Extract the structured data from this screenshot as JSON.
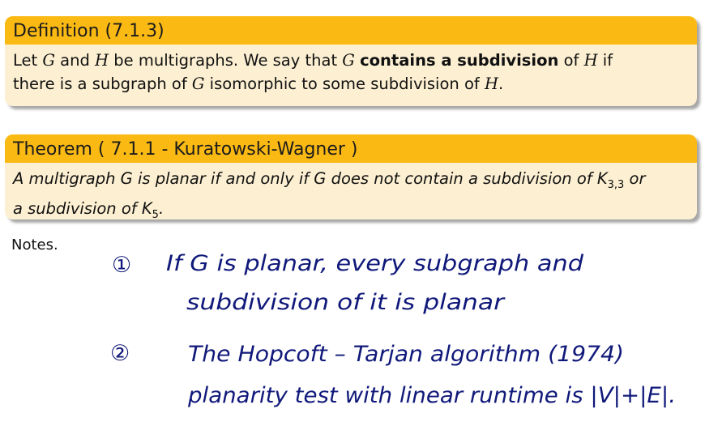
{
  "definition": {
    "title": "Definition (7.1.3)",
    "t1": "Let ",
    "v1": "G",
    "t2": " and ",
    "v2": "H",
    "t3": " be multigraphs. We say that ",
    "v3": "G",
    "t4": " ",
    "bold": "contains a subdivision",
    "t5": " of ",
    "v4": "H",
    "t6": " if",
    "t7": "there is a subgraph of ",
    "v5": "G",
    "t8": " isomorphic to some subdivision of ",
    "v6": "H",
    "t9": "."
  },
  "theorem": {
    "title": "Theorem ( 7.1.1 - Kuratowski-Wagner )",
    "t1": "A multigraph G is planar if and only if G does not contain a subdivision of K",
    "s1": "3,3",
    "t2": " or",
    "t3": "a subdivision of K",
    "s2": "5",
    "t4": "."
  },
  "notes_label": "Notes.",
  "handwriting": {
    "n1": "①",
    "l1": "If  G is  planar,   every  subgraph  and",
    "l2": "subdivision   of  it   is  planar",
    "n2": "②",
    "l3": "The  Hopcoft – Tarjan  algorithm  (1974)",
    "l4": "planarity  test   with  linear  runtime  is  |V|+|E|."
  },
  "colors": {
    "header": "#fbb914",
    "body": "#fdf0d2",
    "ink": "#10197a"
  }
}
